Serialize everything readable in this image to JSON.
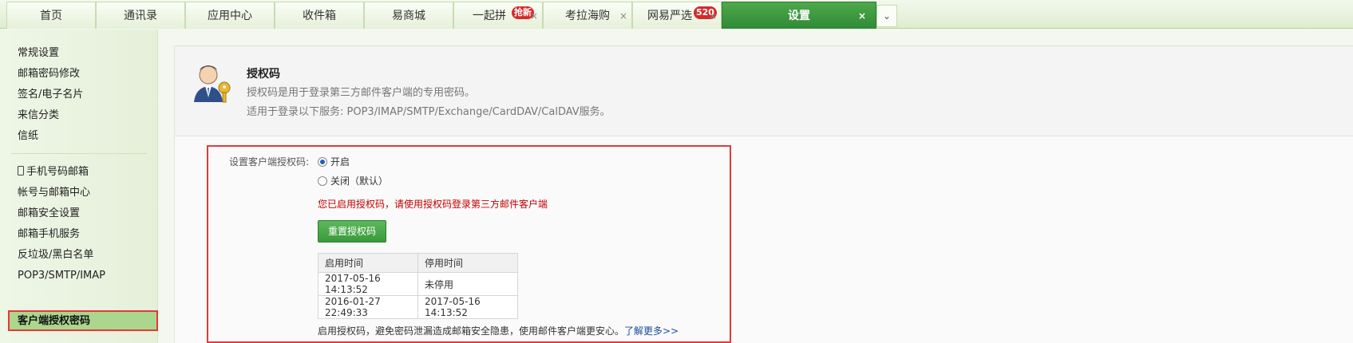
{
  "tabs": [
    {
      "label": "首页",
      "active": false
    },
    {
      "label": "通讯录",
      "active": false
    },
    {
      "label": "应用中心",
      "active": false
    },
    {
      "label": "收件箱",
      "active": false
    },
    {
      "label": "易商城",
      "active": false
    },
    {
      "label": "一起拼",
      "badge": "抢新",
      "closable": true
    },
    {
      "label": "考拉海购",
      "closable": true
    },
    {
      "label": "网易严选",
      "badge": "520",
      "closable": true
    },
    {
      "label": "设置",
      "active": true,
      "closable": true
    }
  ],
  "close_glyph": "×",
  "more_glyph": "⌄",
  "sidebar": {
    "group1": [
      "常规设置",
      "邮箱密码修改",
      "签名/电子名片",
      "来信分类",
      "信纸"
    ],
    "group2": [
      "手机号码邮箱",
      "帐号与邮箱中心",
      "邮箱安全设置",
      "邮箱手机服务",
      "反垃圾/黑白名单",
      "POP3/SMTP/IMAP",
      "客户端授权密码"
    ],
    "phone_icon": "phone-icon"
  },
  "header": {
    "title": "授权码",
    "line1": "授权码是用于登录第三方邮件客户端的专用密码。",
    "line2": "适用于登录以下服务: POP3/IMAP/SMTP/Exchange/CardDAV/CalDAV服务。"
  },
  "settings": {
    "label": "设置客户端授权码:",
    "option_on": "开启",
    "option_off": "关闭（默认）",
    "selected": "开启",
    "warning": "您已启用授权码，请使用授权码登录第三方邮件客户端",
    "reset_button": "重置授权码",
    "table_headers": [
      "启用时间",
      "停用时间"
    ],
    "table_rows": [
      [
        "2017-05-16 14:13:52",
        "未停用"
      ],
      [
        "2016-01-27 22:49:33",
        "2017-05-16 14:13:52"
      ]
    ],
    "footer_text": "启用授权码，避免密码泄漏造成邮箱安全隐患，使用邮件客户端更安心。",
    "footer_link": "了解更多>>"
  },
  "colors": {
    "accent": "#3a9a3a",
    "warning": "#c20000",
    "highlight": "#e53935"
  }
}
